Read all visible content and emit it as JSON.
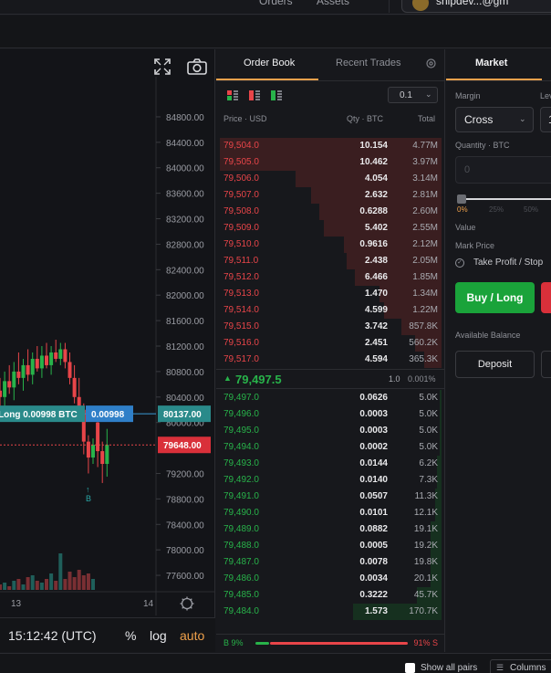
{
  "nav": {
    "items": [
      "Orders",
      "Assets"
    ],
    "user_label": "shipdev...@gm"
  },
  "chart": {
    "symbol_hint": "BTC",
    "y_ticks": [
      "84800.00",
      "84400.00",
      "84000.00",
      "83600.00",
      "83200.00",
      "82800.00",
      "82400.00",
      "82000.00",
      "81600.00",
      "81200.00",
      "80800.00",
      "80400.00",
      "80000.00",
      "79200.00",
      "78800.00",
      "78400.00",
      "78000.00",
      "77600.00"
    ],
    "y_min": 77400,
    "y_max": 85000,
    "last_price_label": "80137.00",
    "mark_price_label": "79648.00",
    "position_label": "Long 0.00998 BTC",
    "position_size_label": "0.00998",
    "trade_marker": "B",
    "x_labels": [
      "13",
      "14"
    ],
    "candles": [
      [
        80500,
        80700,
        80150,
        80400
      ],
      [
        80400,
        80800,
        80200,
        80650
      ],
      [
        80650,
        80900,
        80450,
        80550
      ],
      [
        80550,
        80950,
        80350,
        80800
      ],
      [
        80800,
        81100,
        80600,
        80700
      ],
      [
        80700,
        81000,
        80500,
        80900
      ],
      [
        80900,
        81150,
        80650,
        80750
      ],
      [
        80750,
        81100,
        80600,
        81000
      ],
      [
        81000,
        81200,
        80800,
        80850
      ],
      [
        80850,
        81200,
        80700,
        81050
      ],
      [
        81050,
        81250,
        80850,
        80900
      ],
      [
        80900,
        81200,
        80750,
        81100
      ],
      [
        81100,
        81300,
        80950,
        81000
      ],
      [
        81000,
        81250,
        80900,
        81150
      ],
      [
        81150,
        81250,
        80850,
        80950
      ],
      [
        80950,
        81100,
        80600,
        80700
      ],
      [
        80700,
        80900,
        80300,
        80400
      ],
      [
        80400,
        80700,
        80050,
        80200
      ],
      [
        80200,
        80300,
        79500,
        79700
      ],
      [
        79700,
        79800,
        79200,
        79450
      ],
      [
        79450,
        79750,
        79350,
        79650
      ]
    ],
    "volumes": [
      3,
      4,
      2,
      5,
      6,
      3,
      7,
      8,
      5,
      4,
      6,
      9,
      5,
      20,
      6,
      10,
      7,
      11,
      8,
      9,
      6
    ],
    "toolbar": {
      "time": "15:12:42 (UTC)",
      "percent": "%",
      "log": "log",
      "auto": "auto"
    },
    "fullscreen_icon": "fullscreen-icon",
    "camera_icon": "camera-icon",
    "settings_icon": "gear-icon"
  },
  "orderbook": {
    "tabs": [
      "Order Book",
      "Recent Trades"
    ],
    "precision": "0.1",
    "columns": {
      "price": "Price · USD",
      "qty": "Qty · BTC",
      "total": "Total"
    },
    "asks": [
      {
        "price": "79,504.0",
        "qty": "10.154",
        "total": "4.77M",
        "depth": 1.0
      },
      {
        "price": "79,505.0",
        "qty": "10.462",
        "total": "3.97M",
        "depth": 1.0
      },
      {
        "price": "79,506.0",
        "qty": "4.054",
        "total": "3.14M",
        "depth": 0.66
      },
      {
        "price": "79,507.0",
        "qty": "2.632",
        "total": "2.81M",
        "depth": 0.59
      },
      {
        "price": "79,508.0",
        "qty": "0.6288",
        "total": "2.60M",
        "depth": 0.55
      },
      {
        "price": "79,509.0",
        "qty": "5.402",
        "total": "2.55M",
        "depth": 0.53
      },
      {
        "price": "79,510.0",
        "qty": "0.9616",
        "total": "2.12M",
        "depth": 0.44
      },
      {
        "price": "79,511.0",
        "qty": "2.438",
        "total": "2.05M",
        "depth": 0.43
      },
      {
        "price": "79,512.0",
        "qty": "6.466",
        "total": "1.85M",
        "depth": 0.39
      },
      {
        "price": "79,513.0",
        "qty": "1.470",
        "total": "1.34M",
        "depth": 0.28
      },
      {
        "price": "79,514.0",
        "qty": "4.599",
        "total": "1.22M",
        "depth": 0.26
      },
      {
        "price": "79,515.0",
        "qty": "3.742",
        "total": "857.8K",
        "depth": 0.18
      },
      {
        "price": "79,516.0",
        "qty": "2.451",
        "total": "560.2K",
        "depth": 0.12
      },
      {
        "price": "79,517.0",
        "qty": "4.594",
        "total": "365.3K",
        "depth": 0.08
      }
    ],
    "mid": {
      "arrow": "▲",
      "price": "79,497.5",
      "qty": "1.0",
      "pct": "0.001%"
    },
    "bids": [
      {
        "price": "79,497.0",
        "qty": "0.0626",
        "total": "5.0K",
        "depth": 0.01
      },
      {
        "price": "79,496.0",
        "qty": "0.0003",
        "total": "5.0K",
        "depth": 0.01
      },
      {
        "price": "79,495.0",
        "qty": "0.0003",
        "total": "5.0K",
        "depth": 0.01
      },
      {
        "price": "79,494.0",
        "qty": "0.0002",
        "total": "5.0K",
        "depth": 0.01
      },
      {
        "price": "79,493.0",
        "qty": "0.0144",
        "total": "6.2K",
        "depth": 0.02
      },
      {
        "price": "79,492.0",
        "qty": "0.0140",
        "total": "7.3K",
        "depth": 0.02
      },
      {
        "price": "79,491.0",
        "qty": "0.0507",
        "total": "11.3K",
        "depth": 0.03
      },
      {
        "price": "79,490.0",
        "qty": "0.0101",
        "total": "12.1K",
        "depth": 0.03
      },
      {
        "price": "79,489.0",
        "qty": "0.0882",
        "total": "19.1K",
        "depth": 0.05
      },
      {
        "price": "79,488.0",
        "qty": "0.0005",
        "total": "19.2K",
        "depth": 0.05
      },
      {
        "price": "79,487.0",
        "qty": "0.0078",
        "total": "19.8K",
        "depth": 0.05
      },
      {
        "price": "79,486.0",
        "qty": "0.0034",
        "total": "20.1K",
        "depth": 0.05
      },
      {
        "price": "79,485.0",
        "qty": "0.3222",
        "total": "45.7K",
        "depth": 0.11
      },
      {
        "price": "79,484.0",
        "qty": "1.573",
        "total": "170.7K",
        "depth": 0.4
      }
    ],
    "ratio": {
      "buy_label": "B 9%",
      "sell_label": "91% S",
      "buy_fraction": 0.09
    }
  },
  "order_form": {
    "tab": "Market",
    "margin_label": "Margin",
    "leverage_label": "Lev",
    "margin_value": "Cross",
    "leverage_value": "1",
    "quantity_label": "Quantity · BTC",
    "quantity_placeholder": "0",
    "slider_ticks": [
      "0%",
      "25%",
      "50%"
    ],
    "slider_value": 0,
    "value_label": "Value",
    "mark_price_label": "Mark Price",
    "tpsl_label": "Take Profit / Stop",
    "buy_label": "Buy / Long",
    "available_label": "Available Balance",
    "deposit_label": "Deposit"
  },
  "footer": {
    "show_all_pairs": "Show all pairs",
    "columns": "Columns"
  },
  "colors": {
    "up": "#28b34a",
    "down": "#e84549",
    "accent": "#f0a14b",
    "position_tag": "#2a8a8a"
  }
}
